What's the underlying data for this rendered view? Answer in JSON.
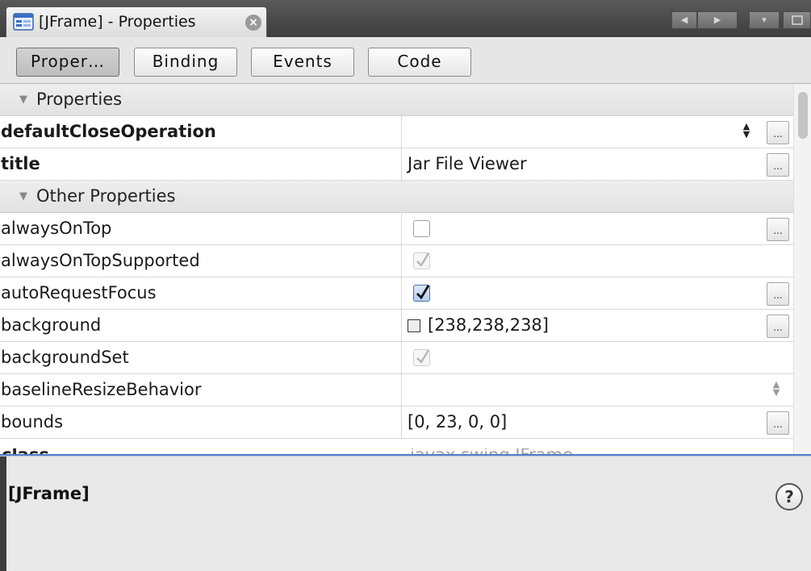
{
  "window": {
    "tab_title": "[JFrame] - Properties",
    "tab_close_glyph": "×",
    "tab_icon": "jframe-form-icon",
    "nav_left_glyph": "◀",
    "nav_right_glyph": "▶",
    "dropdown_glyph": "▾"
  },
  "toolbar": {
    "tabs": [
      {
        "label": "Proper…",
        "active": true
      },
      {
        "label": "Binding",
        "active": false
      },
      {
        "label": "Events",
        "active": false
      },
      {
        "label": "Code",
        "active": false
      }
    ]
  },
  "sheet": {
    "caret": "▼",
    "ellipsis": "...",
    "categories": [
      {
        "label": "Properties"
      },
      {
        "label": "Other Properties"
      }
    ],
    "rows": [
      {
        "name": "defaultCloseOperation",
        "value": ""
      },
      {
        "name": "title",
        "value": "Jar File Viewer"
      },
      {
        "name": "alwaysOnTop",
        "value": ""
      },
      {
        "name": "alwaysOnTopSupported",
        "value": ""
      },
      {
        "name": "autoRequestFocus",
        "value": ""
      },
      {
        "name": "background",
        "value": "[238,238,238]"
      },
      {
        "name": "backgroundSet",
        "value": ""
      },
      {
        "name": "baselineResizeBehavior",
        "value": ""
      },
      {
        "name": "bounds",
        "value": "[0, 23, 0, 0]"
      },
      {
        "name": "class",
        "value": "javax.swing.JFrame"
      }
    ],
    "checkbox_states": {
      "alwaysOnTop": "unchecked",
      "alwaysOnTopSupported": "checked-disabled",
      "autoRequestFocus": "checked",
      "backgroundSet": "checked-disabled"
    },
    "background_swatch_color": "#eeeeee"
  },
  "description": {
    "title": "[JFrame]",
    "help_glyph": "?"
  }
}
